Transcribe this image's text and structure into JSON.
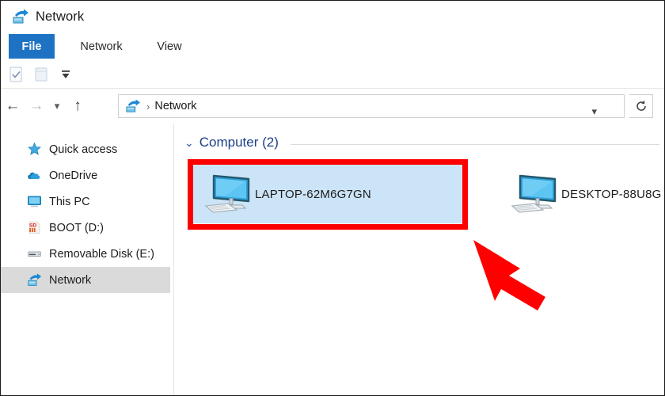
{
  "window": {
    "title": "Network",
    "title_icon": "network-icon"
  },
  "ribbon": {
    "tabs": [
      {
        "label": "File",
        "active": true,
        "name": "tab-file"
      },
      {
        "label": "Network",
        "active": false,
        "name": "tab-network"
      },
      {
        "label": "View",
        "active": false,
        "name": "tab-view"
      }
    ]
  },
  "quick_access_toolbar": {
    "buttons": [
      {
        "name": "properties-icon",
        "label": "Properties"
      },
      {
        "name": "new-folder-icon",
        "label": "New folder"
      }
    ],
    "customize_icon": "chevron-down-icon"
  },
  "address_bar": {
    "back_icon": "back-arrow-icon",
    "forward_icon": "forward-arrow-icon",
    "recent_icon": "chevron-down-icon",
    "up_icon": "up-arrow-icon",
    "path_icon": "network-icon",
    "separator": "›",
    "crumb": "Network",
    "dropdown_icon": "chevron-down-icon",
    "refresh_icon": "refresh-icon"
  },
  "sidebar": {
    "items": [
      {
        "label": "Quick access",
        "icon": "star-icon",
        "selected": false
      },
      {
        "label": "OneDrive",
        "icon": "cloud-icon",
        "selected": false
      },
      {
        "label": "This PC",
        "icon": "monitor-icon",
        "selected": false
      },
      {
        "label": "BOOT (D:)",
        "icon": "sd-card-icon",
        "selected": false
      },
      {
        "label": "Removable Disk (E:)",
        "icon": "removable-disk-icon",
        "selected": false
      },
      {
        "label": "Network",
        "icon": "network-icon",
        "selected": true
      }
    ]
  },
  "content": {
    "group": {
      "chevron": "⌄",
      "label": "Computer (2)"
    },
    "items": [
      {
        "label": "LAPTOP-62M6G7GN",
        "icon": "computer-icon",
        "selected": true
      },
      {
        "label": "DESKTOP-88U8G",
        "icon": "computer-icon",
        "selected": false
      }
    ]
  },
  "annotations": {
    "highlight_color": "#ff0000",
    "arrow_color": "#ff0000",
    "highlight_target": "LAPTOP-62M6G7GN"
  },
  "colors": {
    "accent_blue": "#1e72c4",
    "selection_blue": "#cce4f7",
    "group_header_blue": "#1b3f87",
    "sidebar_selected_gray": "#dadada"
  }
}
